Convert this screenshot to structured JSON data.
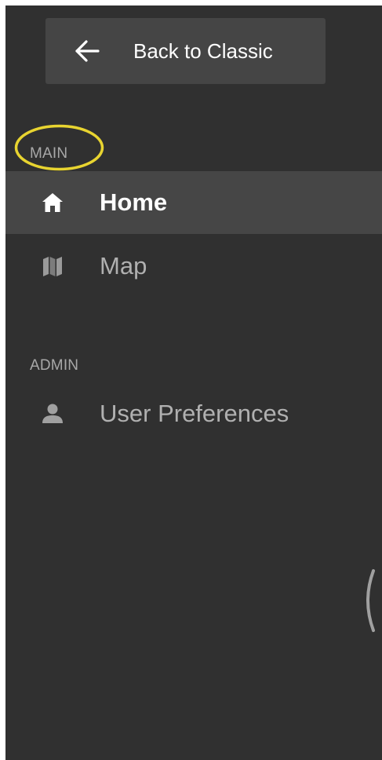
{
  "sidebar": {
    "back_button": {
      "label": "Back to Classic",
      "icon": "arrow-left-icon"
    },
    "sections": [
      {
        "header": "MAIN",
        "items": [
          {
            "label": "Home",
            "icon": "home-icon",
            "active": true
          },
          {
            "label": "Map",
            "icon": "map-icon",
            "active": false
          }
        ]
      },
      {
        "header": "ADMIN",
        "items": [
          {
            "label": "User Preferences",
            "icon": "user-icon",
            "active": false
          }
        ]
      }
    ],
    "collapse_handle_icon": "chevron-left-icon"
  },
  "colors": {
    "sidebar_bg": "#303030",
    "button_bg": "#454545",
    "active_item_bg": "#464646",
    "active_text": "#ffffff",
    "inactive_text": "#b0b0b0",
    "section_header_text": "#a8a8a8",
    "highlight_ring": "#e8d430",
    "collapse_handle": "#a0a0a0"
  }
}
